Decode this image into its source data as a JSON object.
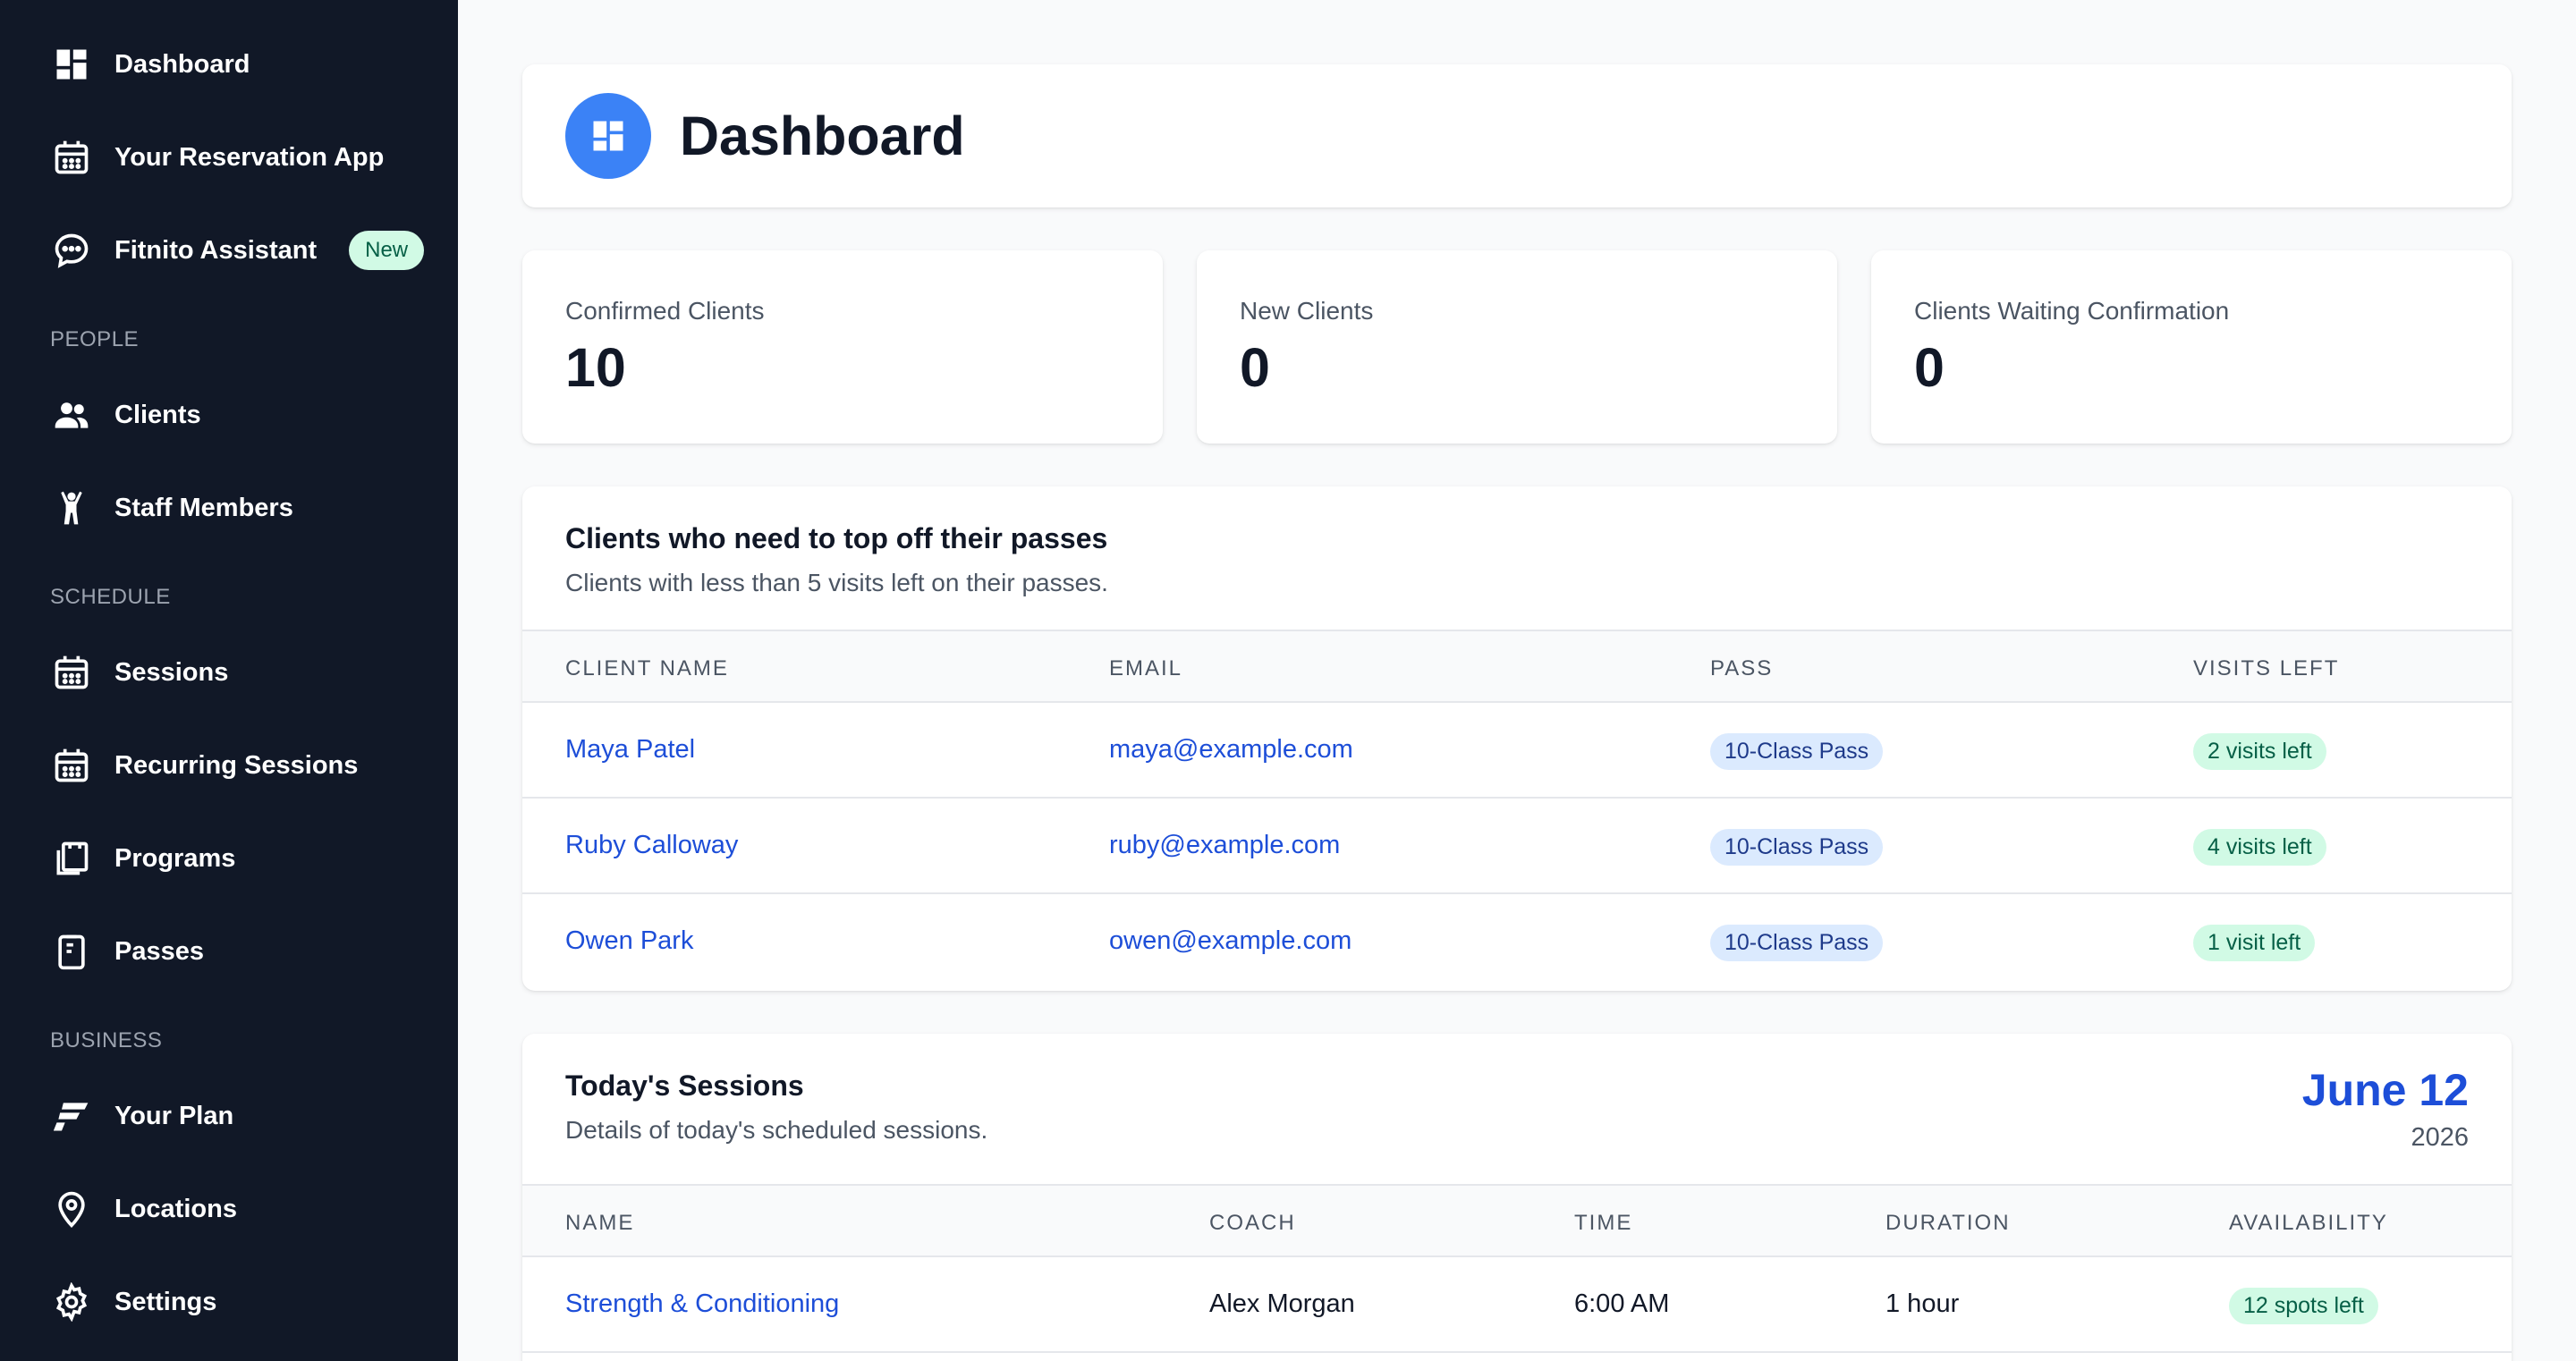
{
  "sidebar": {
    "items": [
      {
        "label": "Dashboard",
        "icon": "dashboard-icon"
      },
      {
        "label": "Your Reservation App",
        "icon": "calendar-icon"
      },
      {
        "label": "Fitnito Assistant",
        "icon": "chat-icon",
        "badge": "New"
      }
    ],
    "people": {
      "title": "PEOPLE",
      "items": [
        {
          "label": "Clients",
          "icon": "users-icon"
        },
        {
          "label": "Staff Members",
          "icon": "person-icon"
        }
      ]
    },
    "schedule": {
      "title": "SCHEDULE",
      "items": [
        {
          "label": "Sessions",
          "icon": "calendar-icon"
        },
        {
          "label": "Recurring Sessions",
          "icon": "calendar-icon"
        },
        {
          "label": "Programs",
          "icon": "clipboard-icon"
        },
        {
          "label": "Passes",
          "icon": "pass-icon"
        }
      ]
    },
    "business": {
      "title": "BUSINESS",
      "items": [
        {
          "label": "Your Plan",
          "icon": "brand-f-icon"
        },
        {
          "label": "Locations",
          "icon": "location-pin-icon"
        },
        {
          "label": "Settings",
          "icon": "gear-icon"
        }
      ]
    }
  },
  "header": {
    "title": "Dashboard",
    "icon": "dashboard-icon"
  },
  "stats": [
    {
      "label": "Confirmed Clients",
      "value": "10"
    },
    {
      "label": "New Clients",
      "value": "0"
    },
    {
      "label": "Clients Waiting Confirmation",
      "value": "0"
    }
  ],
  "passes_section": {
    "title": "Clients who need to top off their passes",
    "subtitle": "Clients with less than 5 visits left on their passes.",
    "columns": [
      "CLIENT NAME",
      "EMAIL",
      "PASS",
      "VISITS LEFT"
    ],
    "rows": [
      {
        "name": "Maya Patel",
        "email": "maya@example.com",
        "pass": "10-Class Pass",
        "visits": "2 visits left"
      },
      {
        "name": "Ruby Calloway",
        "email": "ruby@example.com",
        "pass": "10-Class Pass",
        "visits": "4 visits left"
      },
      {
        "name": "Owen Park",
        "email": "owen@example.com",
        "pass": "10-Class Pass",
        "visits": "1 visit left"
      }
    ]
  },
  "sessions_section": {
    "title": "Today's Sessions",
    "subtitle": "Details of today's scheduled sessions.",
    "date": "June 12",
    "year": "2026",
    "columns": [
      "NAME",
      "COACH",
      "TIME",
      "DURATION",
      "AVAILABILITY"
    ],
    "rows": [
      {
        "name": "Strength & Conditioning",
        "coach": "Alex Morgan",
        "time": "6:00 AM",
        "duration": "1 hour",
        "availability": "12 spots left"
      }
    ]
  },
  "colors": {
    "sidebar_bg": "#111827",
    "accent": "#3b82f6",
    "link": "#1d4ed8",
    "badge_green": "#d1fae5",
    "badge_blue": "#dbeafe"
  }
}
